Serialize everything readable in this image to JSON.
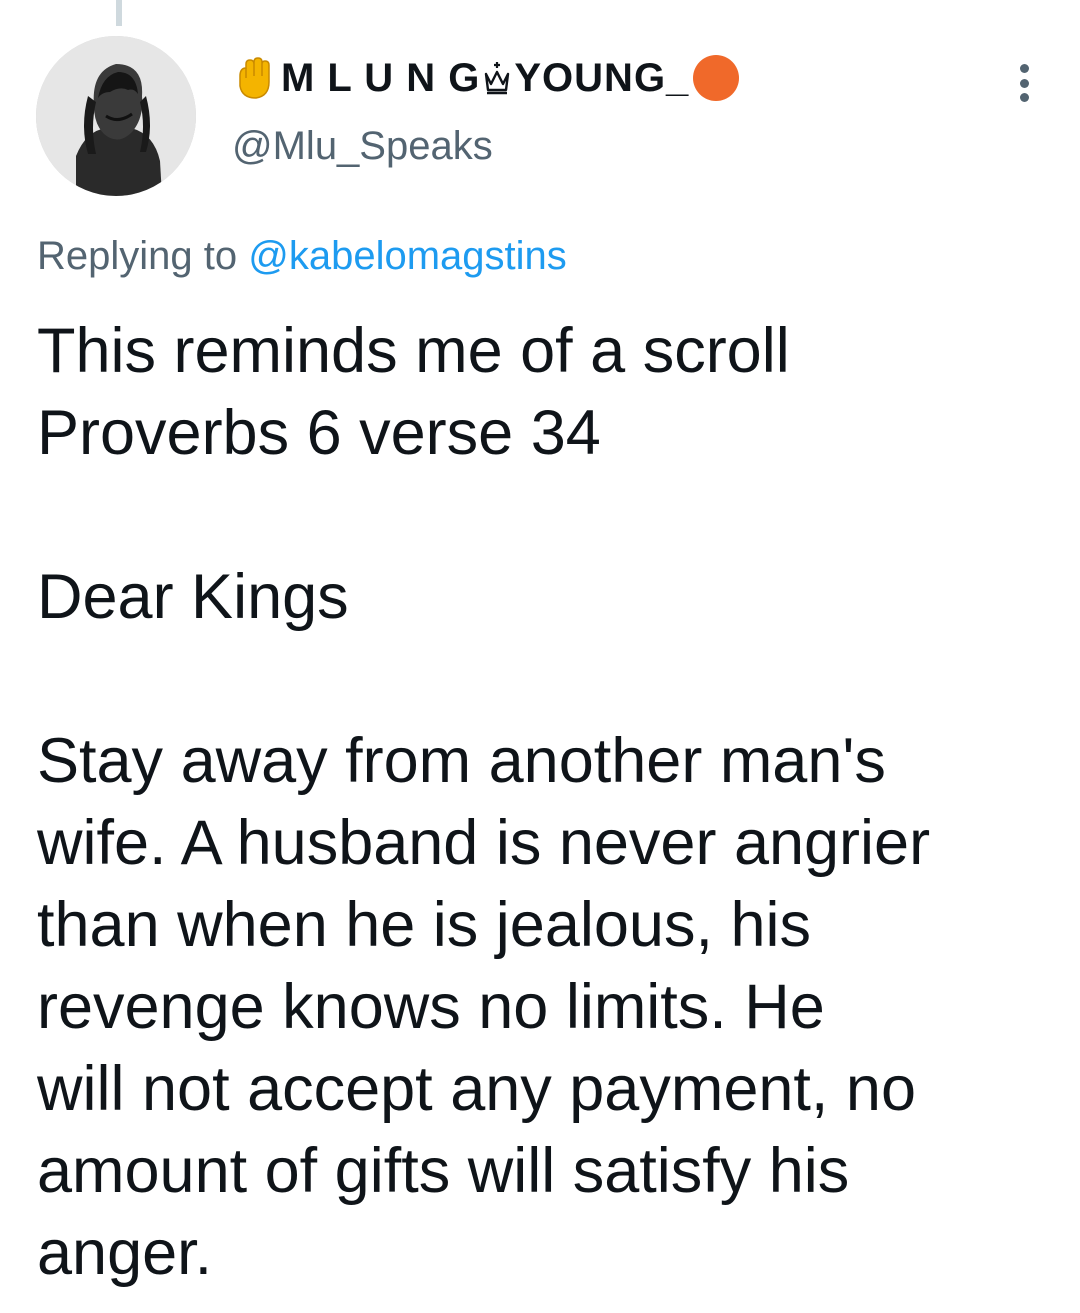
{
  "tweet": {
    "author": {
      "display_name_prefix": "󠁧M L U N G",
      "display_name_suffix": "YOUNG_",
      "handle": "@Mlu_Speaks",
      "icons": [
        "raised-fist-icon",
        "crown-icon",
        "orange-circle-icon"
      ],
      "orange_dot_color": "#f0692a"
    },
    "replying_prefix": "Replying to ",
    "replying_to": "@kabelomagstins",
    "paragraphs": [
      "This reminds me of a scroll\nProverbs 6 verse 34",
      "Dear Kings",
      "Stay away from another man's\nwife. A husband is never angrier\nthan when he is jealous, his\nrevenge knows no limits. He\nwill not accept any payment, no\namount of gifts will satisfy his\nanger."
    ]
  },
  "colors": {
    "text_primary": "#0f1419",
    "text_secondary": "#536471",
    "link": "#1d9bf0"
  }
}
